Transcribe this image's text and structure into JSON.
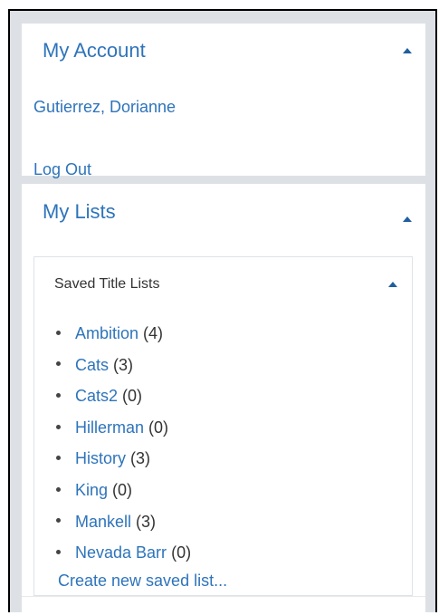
{
  "account": {
    "title": "My Account",
    "user_name": "Gutierrez, Dorianne",
    "logout_label": "Log Out"
  },
  "lists": {
    "title": "My Lists",
    "saved": {
      "title": "Saved Title Lists",
      "items": [
        {
          "name": "Ambition",
          "count": "(4)"
        },
        {
          "name": "Cats",
          "count": "(3)"
        },
        {
          "name": "Cats2",
          "count": "(0)"
        },
        {
          "name": "Hillerman",
          "count": "(0)"
        },
        {
          "name": "History",
          "count": "(3)"
        },
        {
          "name": "King",
          "count": "(0)"
        },
        {
          "name": "Mankell",
          "count": "(3)"
        },
        {
          "name": "Nevada Barr",
          "count": "(0)"
        }
      ],
      "create_label": "Create new saved list..."
    }
  },
  "colors": {
    "link": "#2e74bb",
    "background": "#dde1e5",
    "caret": "#1f5f9e"
  }
}
